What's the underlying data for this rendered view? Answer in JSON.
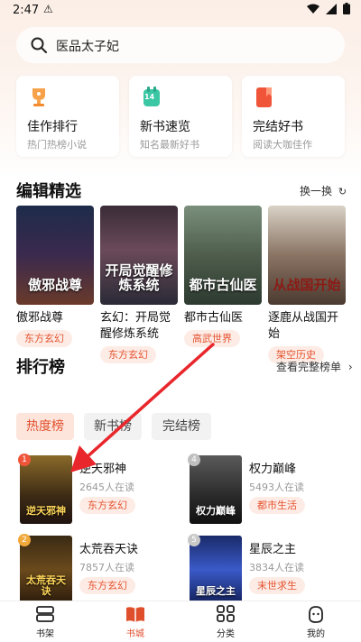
{
  "status_bar": {
    "time": "2:47",
    "warning": "⚠"
  },
  "search": {
    "text": "医品太子妃"
  },
  "quick_cards": [
    {
      "title": "佳作排行",
      "subtitle": "热门热榜小说",
      "icon": "trophy-icon"
    },
    {
      "title": "新书速览",
      "subtitle": "知名最新好书",
      "icon": "new-book-icon",
      "badge": "14"
    },
    {
      "title": "完结好书",
      "subtitle": "阅读大咖佳作",
      "icon": "finished-book-icon"
    }
  ],
  "editor_picks": {
    "title": "编辑精选",
    "refresh_label": "换一换",
    "books": [
      {
        "title": "傲邪战尊",
        "tag": "东方玄幻",
        "cover_text": "傲邪战尊"
      },
      {
        "title": "玄幻：开局觉醒修炼系统",
        "tag": "东方玄幻",
        "cover_text": "开局觉醒修炼系统"
      },
      {
        "title": "都市古仙医",
        "tag": "高武世界",
        "cover_text": "都市古仙医"
      },
      {
        "title": "逐鹿从战国开始",
        "tag": "架空历史",
        "cover_text": "从战国开始"
      }
    ]
  },
  "rankings": {
    "title": "排行榜",
    "view_all_label": "查看完整榜单",
    "tabs": [
      "热度榜",
      "新书榜",
      "完结榜"
    ],
    "active_tab": 0,
    "items": [
      {
        "rank": "1",
        "title": "逆天邪神",
        "readers": "2645人在读",
        "tag": "东方玄幻",
        "cover_text": "逆天邪神"
      },
      {
        "rank": "4",
        "title": "权力巅峰",
        "readers": "5493人在读",
        "tag": "都市生活",
        "cover_text": "权力巅峰"
      },
      {
        "rank": "2",
        "title": "太荒吞天诀",
        "readers": "7857人在读",
        "tag": "东方玄幻",
        "cover_text": "太荒吞天诀"
      },
      {
        "rank": "5",
        "title": "星辰之主",
        "readers": "3834人在读",
        "tag": "末世求生",
        "cover_text": "星辰之主"
      }
    ]
  },
  "bottom_nav": {
    "items": [
      {
        "label": "书架",
        "icon": "bookshelf-icon"
      },
      {
        "label": "书城",
        "icon": "book-store-icon"
      },
      {
        "label": "分类",
        "icon": "category-icon"
      },
      {
        "label": "我的",
        "icon": "profile-icon"
      }
    ],
    "active": 1
  },
  "colors": {
    "accent": "#e04f2c",
    "tag_bg": "#fdece6",
    "annotation_arrow": "#e8262b"
  }
}
